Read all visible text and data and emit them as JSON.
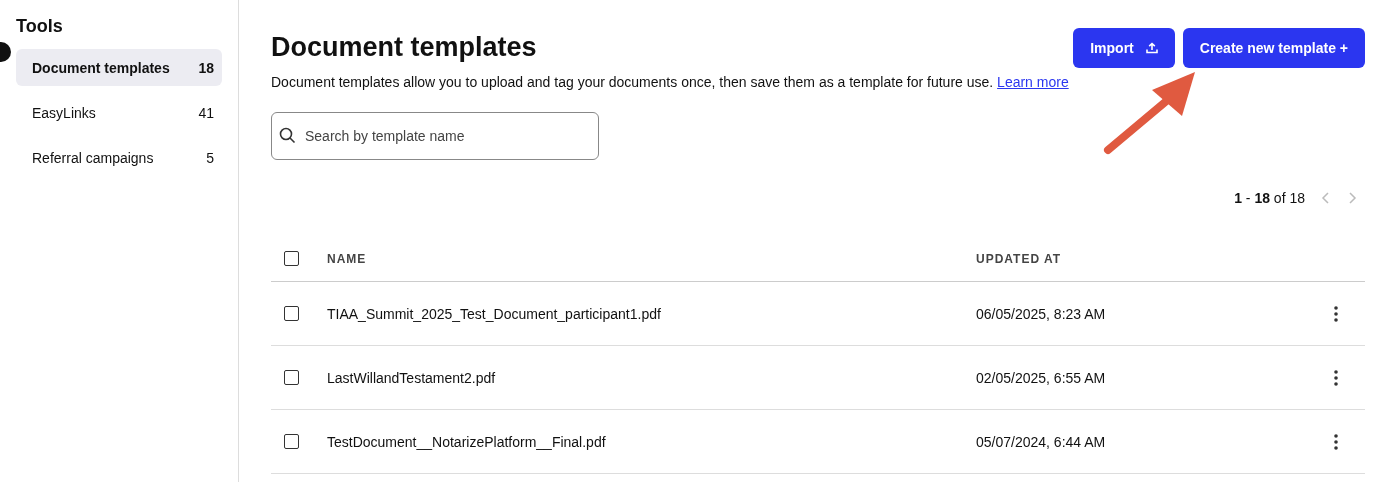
{
  "sidebar": {
    "title": "Tools",
    "items": [
      {
        "label": "Document templates",
        "count": "18",
        "selected": true
      },
      {
        "label": "EasyLinks",
        "count": "41",
        "selected": false
      },
      {
        "label": "Referral campaigns",
        "count": "5",
        "selected": false
      }
    ]
  },
  "header": {
    "title": "Document templates",
    "description": "Document templates allow you to upload and tag your documents once, then save them as a template for future use.",
    "link": "Learn more",
    "buttons": [
      {
        "label": "Import",
        "kind": "import"
      },
      {
        "label": "Create new template +",
        "kind": "create"
      }
    ]
  },
  "search": {
    "placeholder": "Search by template name"
  },
  "pagination": {
    "range": "**1** - **18** of 18",
    "prev_disabled": true,
    "next_disabled": true
  },
  "table": {
    "select_all_checked": false,
    "columns": [
      "NAME",
      "UPDATED AT"
    ],
    "rows": [
      {
        "name": "TIAA_Summit_2025_Test_Document_participant1.pdf",
        "updated": "06/05/2025, 8:23 AM",
        "checked": false
      },
      {
        "name": "LastWillandTestament2.pdf",
        "updated": "02/05/2025, 6:55 AM",
        "checked": false
      },
      {
        "name": "TestDocument__NotarizePlatform__Final.pdf",
        "updated": "05/07/2024, 6:44 AM",
        "checked": false
      }
    ]
  }
}
